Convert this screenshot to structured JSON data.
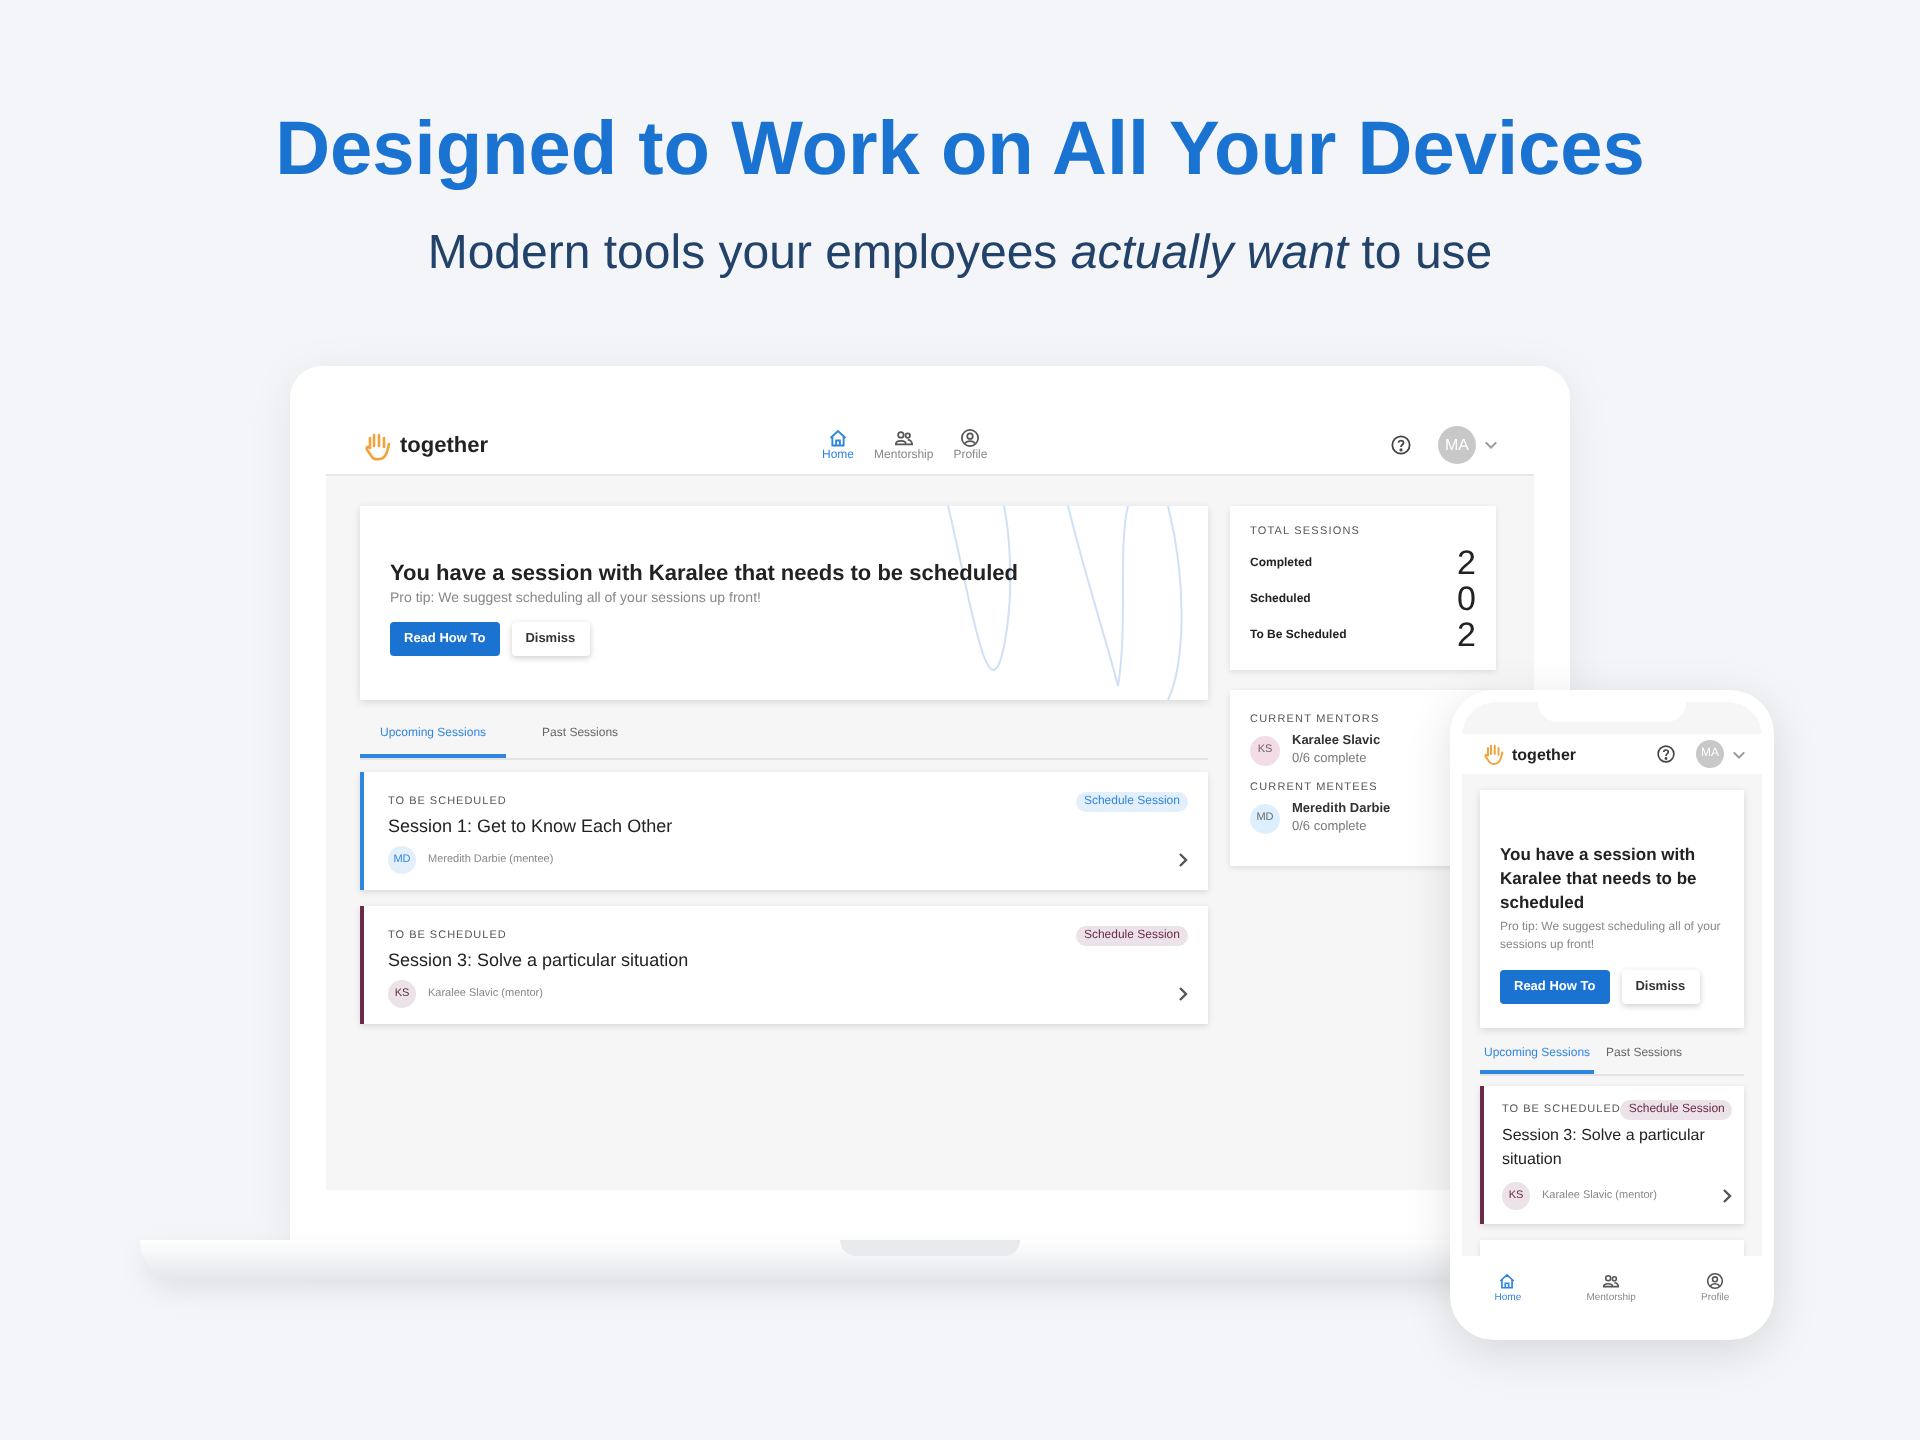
{
  "headline": "Designed to Work on All Your Devices",
  "subheadline": "Modern tools your employees *actually want* to use",
  "laptop": {
    "logo": "together",
    "nav": [
      {
        "label": "Home",
        "kind": "home",
        "selected": true
      },
      {
        "label": "Mentorship",
        "kind": "people",
        "selected": false
      },
      {
        "label": "Profile",
        "kind": "profile",
        "selected": false
      }
    ],
    "avatar": "MA",
    "banner": {
      "title": "You have a session with Karalee that needs to be scheduled",
      "tip": "Pro tip: We suggest scheduling all of your sessions up front!",
      "buttons": [
        {
          "label": "Read How To",
          "kind": "primary"
        },
        {
          "label": "Dismiss",
          "kind": "secondary"
        }
      ]
    },
    "tabs": [
      {
        "label": "Upcoming Sessions",
        "selected": true
      },
      {
        "label": "Past Sessions",
        "selected": false
      }
    ],
    "sessions": [
      {
        "status": "TO BE SCHEDULED",
        "title": "Session 1: Get to Know Each Other",
        "action": "Schedule Session",
        "initials": "MD",
        "person": "Meredith Darbie (mentee)",
        "color": "#2f86e0"
      },
      {
        "status": "TO BE SCHEDULED",
        "title": "Session 3: Solve a particular situation",
        "action": "Schedule Session",
        "initials": "KS",
        "person": "Karalee Slavic (mentor)",
        "color": "#6b2a4a"
      }
    ],
    "totals": {
      "title": "TOTAL SESSIONS",
      "rows": [
        {
          "label": "Completed",
          "value": "2"
        },
        {
          "label": "Scheduled",
          "value": "0"
        },
        {
          "label": "To Be Scheduled",
          "value": "2"
        }
      ]
    },
    "groups": [
      {
        "title": "CURRENT MENTORS",
        "people": [
          {
            "initials": "KS",
            "name": "Karalee Slavic",
            "progress": "0/6 complete",
            "color": "#f3dce6"
          }
        ]
      },
      {
        "title": "CURRENT MENTEES",
        "people": [
          {
            "initials": "MD",
            "name": "Meredith Darbie",
            "progress": "0/6 complete",
            "color": "#ddeefc"
          }
        ]
      }
    ]
  },
  "phone": {
    "logo": "together",
    "avatar": "MA",
    "banner": {
      "title": "You have a session with Karalee that needs to be scheduled",
      "tip": "Pro tip: We suggest scheduling all of your sessions up front!",
      "buttons": [
        {
          "label": "Read How To",
          "kind": "primary"
        },
        {
          "label": "Dismiss",
          "kind": "secondary"
        }
      ]
    },
    "tabs": [
      {
        "label": "Upcoming Sessions",
        "selected": true
      },
      {
        "label": "Past Sessions",
        "selected": false
      }
    ],
    "sessions": [
      {
        "status": "TO BE SCHEDULED",
        "title": "Session 3: Solve a particular situation",
        "action": "Schedule Session",
        "initials": "KS",
        "person": "Karalee Slavic (mentor)",
        "color": "#6b2a4a"
      }
    ],
    "nav": [
      {
        "label": "Home",
        "kind": "home",
        "selected": true
      },
      {
        "label": "Mentorship",
        "kind": "people",
        "selected": false
      },
      {
        "label": "Profile",
        "kind": "profile",
        "selected": false
      }
    ]
  }
}
